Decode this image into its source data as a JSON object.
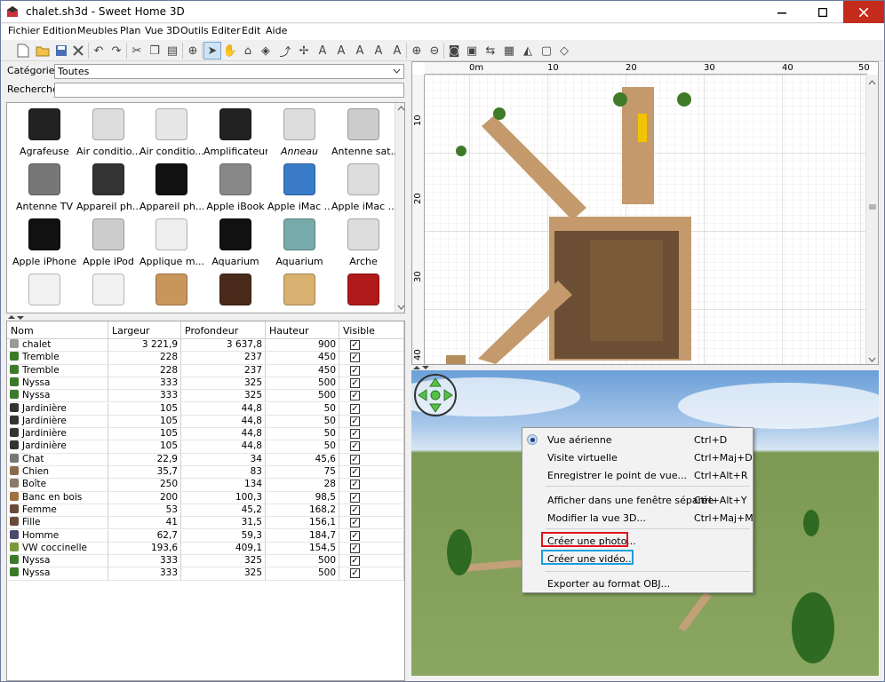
{
  "window": {
    "title": "chalet.sh3d - Sweet Home 3D"
  },
  "menubar": {
    "items": [
      "Fichier",
      "Edition",
      "Meubles",
      "Plan",
      "Vue 3D",
      "Outils",
      "Editer",
      "Edit",
      "Aide"
    ]
  },
  "catalog": {
    "category_label": "Catégorie:",
    "category_value": "Toutes",
    "search_label": "Recherche:",
    "search_value": "",
    "items": [
      {
        "name": "Agrafeuse",
        "icon": "stapler-icon"
      },
      {
        "name": "Air conditio...",
        "icon": "air-conditioner-icon"
      },
      {
        "name": "Air conditio...",
        "icon": "air-conditioner-wall-icon"
      },
      {
        "name": "Amplificateur",
        "icon": "amplifier-icon"
      },
      {
        "name": "Anneau",
        "icon": "ring-icon",
        "italic": true
      },
      {
        "name": "Antenne sat...",
        "icon": "satellite-dish-icon"
      },
      {
        "name": "Antenne TV",
        "icon": "tv-antenna-icon"
      },
      {
        "name": "Appareil ph...",
        "icon": "compact-camera-icon"
      },
      {
        "name": "Appareil ph...",
        "icon": "dslr-camera-icon"
      },
      {
        "name": "Apple iBook",
        "icon": "laptop-icon"
      },
      {
        "name": "Apple iMac ...",
        "icon": "imac-g3-icon"
      },
      {
        "name": "Apple iMac ...",
        "icon": "imac-icon"
      },
      {
        "name": "Apple iPhone",
        "icon": "iphone-icon"
      },
      {
        "name": "Apple iPod",
        "icon": "ipod-icon"
      },
      {
        "name": "Applique m...",
        "icon": "wall-lamp-icon"
      },
      {
        "name": "Aquarium",
        "icon": "aquarium-stand-icon"
      },
      {
        "name": "Aquarium",
        "icon": "aquarium-icon"
      },
      {
        "name": "Arche",
        "icon": "arch-icon"
      },
      {
        "name": "",
        "icon": "white-cabinet-icon"
      },
      {
        "name": "",
        "icon": "white-wardrobe-icon"
      },
      {
        "name": "",
        "icon": "wood-cabinet-icon"
      },
      {
        "name": "",
        "icon": "dark-wardrobe-icon"
      },
      {
        "name": "",
        "icon": "light-wood-cabinet-icon"
      },
      {
        "name": "",
        "icon": "red-cabinet-icon"
      }
    ]
  },
  "furniture": {
    "columns": [
      "Nom",
      "Largeur",
      "Profondeur",
      "Hauteur",
      "Visible"
    ],
    "rows": [
      {
        "name": "chalet",
        "w": "3 221,9",
        "d": "3 637,8",
        "h": "900",
        "icon": "house-icon"
      },
      {
        "name": "Tremble",
        "w": "228",
        "d": "237",
        "h": "450",
        "icon": "tree-icon"
      },
      {
        "name": "Tremble",
        "w": "228",
        "d": "237",
        "h": "450",
        "icon": "tree-icon"
      },
      {
        "name": "Nyssa",
        "w": "333",
        "d": "325",
        "h": "500",
        "icon": "tree-icon"
      },
      {
        "name": "Nyssa",
        "w": "333",
        "d": "325",
        "h": "500",
        "icon": "tree-icon"
      },
      {
        "name": "Jardinière",
        "w": "105",
        "d": "44,8",
        "h": "50",
        "icon": "planter-icon"
      },
      {
        "name": "Jardinière",
        "w": "105",
        "d": "44,8",
        "h": "50",
        "icon": "planter-icon"
      },
      {
        "name": "Jardinière",
        "w": "105",
        "d": "44,8",
        "h": "50",
        "icon": "planter-icon"
      },
      {
        "name": "Jardinière",
        "w": "105",
        "d": "44,8",
        "h": "50",
        "icon": "planter-icon"
      },
      {
        "name": "Chat",
        "w": "22,9",
        "d": "34",
        "h": "45,6",
        "icon": "cat-icon"
      },
      {
        "name": "Chien",
        "w": "35,7",
        "d": "83",
        "h": "75",
        "icon": "dog-icon"
      },
      {
        "name": "Boîte",
        "w": "250",
        "d": "134",
        "h": "28",
        "icon": "box-icon"
      },
      {
        "name": "Banc en bois",
        "w": "200",
        "d": "100,3",
        "h": "98,5",
        "icon": "bench-icon"
      },
      {
        "name": "Femme",
        "w": "53",
        "d": "45,2",
        "h": "168,2",
        "icon": "woman-icon"
      },
      {
        "name": "Fille",
        "w": "41",
        "d": "31,5",
        "h": "156,1",
        "icon": "girl-icon"
      },
      {
        "name": "Homme",
        "w": "62,7",
        "d": "59,3",
        "h": "184,7",
        "icon": "man-icon"
      },
      {
        "name": "VW coccinelle",
        "w": "193,6",
        "d": "409,1",
        "h": "154,5",
        "icon": "car-icon"
      },
      {
        "name": "Nyssa",
        "w": "333",
        "d": "325",
        "h": "500",
        "icon": "tree-icon"
      },
      {
        "name": "Nyssa",
        "w": "333",
        "d": "325",
        "h": "500",
        "icon": "tree-icon"
      }
    ]
  },
  "plan": {
    "ruler_x": [
      "0m",
      "10",
      "20",
      "30",
      "40",
      "50"
    ],
    "ruler_y": [
      "10",
      "20",
      "30",
      "40"
    ]
  },
  "context_menu": {
    "items": [
      {
        "label": "Vue aérienne",
        "shortcut": "Ctrl+D",
        "selected": true
      },
      {
        "label": "Visite virtuelle",
        "shortcut": "Ctrl+Maj+D"
      },
      {
        "label": "Enregistrer le point de vue...",
        "shortcut": "Ctrl+Alt+R"
      },
      {
        "label": "Afficher dans une fenêtre séparée",
        "shortcut": "Ctrl+Alt+Y"
      },
      {
        "label": "Modifier la vue 3D...",
        "shortcut": "Ctrl+Maj+M"
      },
      {
        "label": "Créer une photo...",
        "shortcut": ""
      },
      {
        "label": "Créer une vidéo...",
        "shortcut": ""
      },
      {
        "label": "Exporter au format OBJ...",
        "shortcut": ""
      }
    ]
  },
  "colors": {
    "highlight_photo": "#e0141e",
    "highlight_video": "#1aa0de",
    "close_button": "#c42b1c"
  }
}
